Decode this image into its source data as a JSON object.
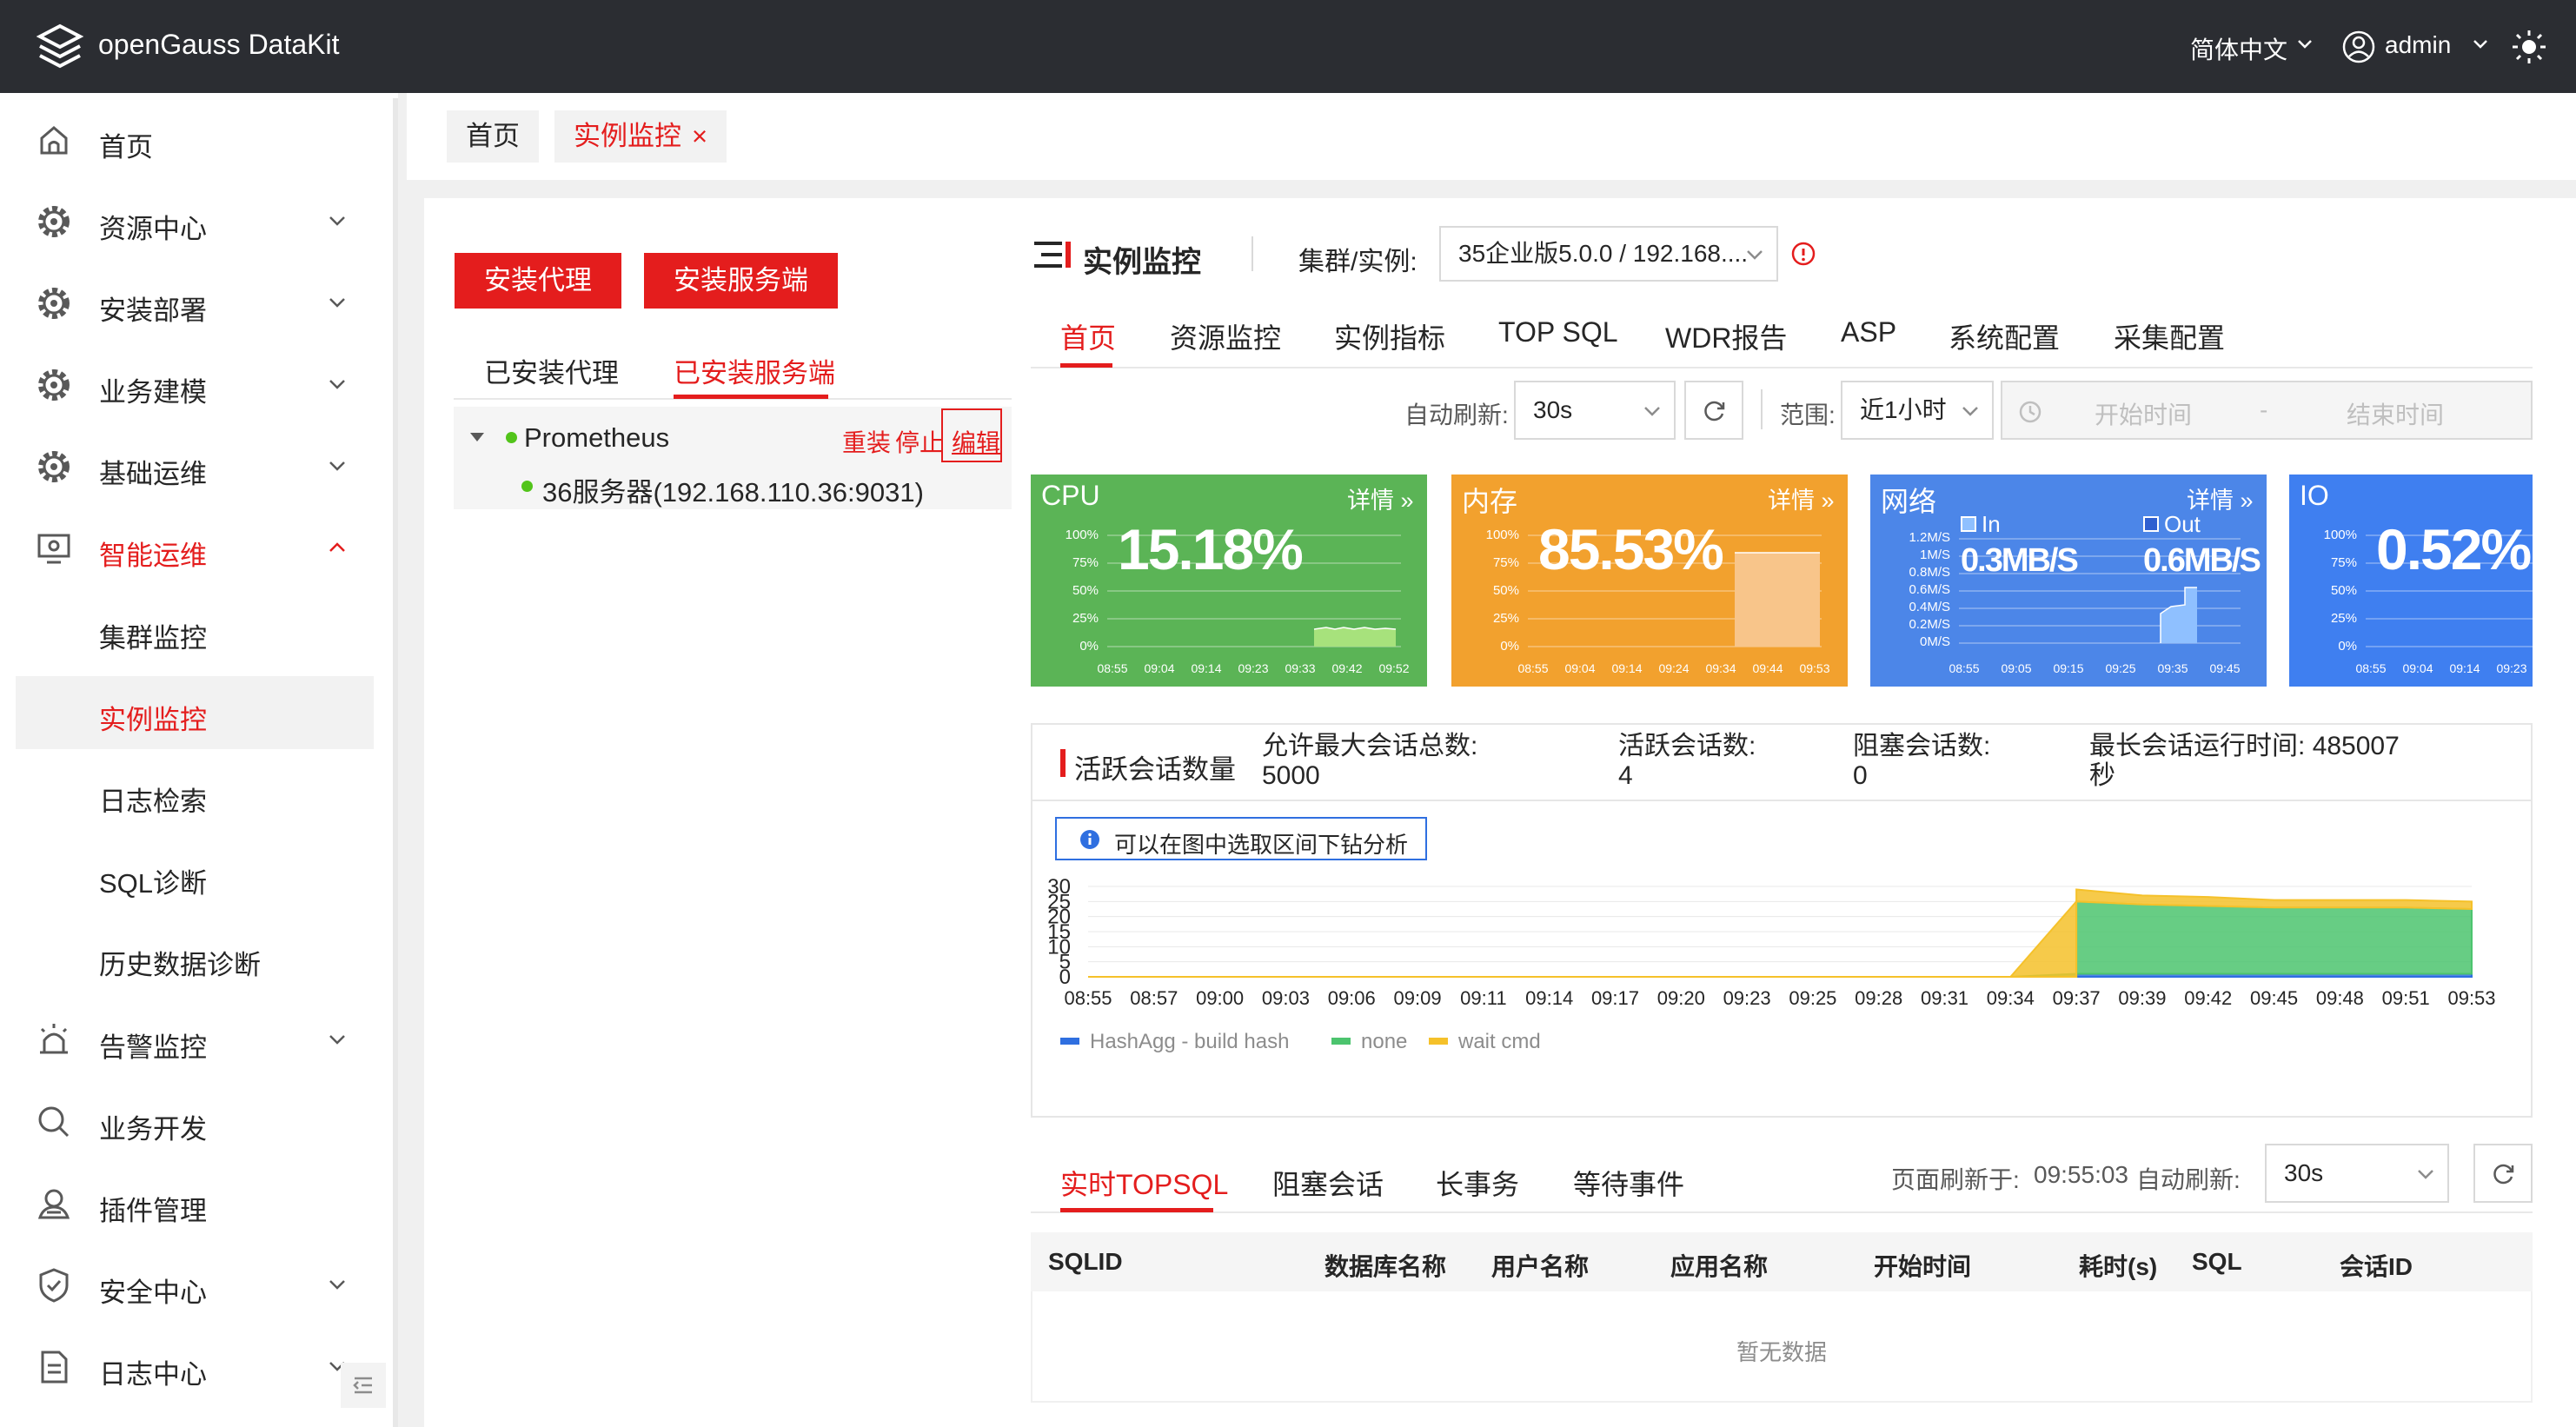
{
  "app": {
    "title": "openGauss DataKit",
    "language": "简体中文",
    "user": "admin"
  },
  "sidebar": {
    "items": [
      {
        "label": "首页",
        "icon": "home-icon"
      },
      {
        "label": "资源中心",
        "icon": "gear-icon"
      },
      {
        "label": "安装部署",
        "icon": "gear-icon"
      },
      {
        "label": "业务建模",
        "icon": "gear-icon"
      },
      {
        "label": "基础运维",
        "icon": "gear-icon"
      },
      {
        "label": "智能运维",
        "icon": "monitor-icon"
      },
      {
        "label": "告警监控",
        "icon": "alarm-icon"
      },
      {
        "label": "业务开发",
        "icon": "search-icon"
      },
      {
        "label": "插件管理",
        "icon": "plugin-icon"
      },
      {
        "label": "安全中心",
        "icon": "shield-icon"
      },
      {
        "label": "日志中心",
        "icon": "document-icon"
      }
    ],
    "subitems": [
      "集群监控",
      "实例监控",
      "日志检索",
      "SQL诊断",
      "历史数据诊断"
    ]
  },
  "page_tabs": [
    {
      "label": "首页"
    },
    {
      "label": "实例监控",
      "close": "×"
    }
  ],
  "left_panel": {
    "install_agent": "安装代理",
    "install_server": "安装服务端",
    "tab_agent": "已安装代理",
    "tab_server": "已安装服务端",
    "tree_root": "Prometheus",
    "tree_child": "36服务器(192.168.110.36:9031)",
    "action_reinstall": "重装",
    "action_stop": "停止",
    "action_edit": "编辑"
  },
  "monitor": {
    "title": "实例监控",
    "cluster_label": "集群/实例:",
    "cluster_value": "35企业版5.0.0 / 192.168....",
    "tabs": [
      "首页",
      "资源监控",
      "实例指标",
      "TOP SQL",
      "WDR报告",
      "ASP",
      "系统配置",
      "采集配置"
    ],
    "auto_refresh_label": "自动刷新:",
    "auto_refresh_value": "30s",
    "range_label": "范围:",
    "range_value": "近1小时",
    "start_placeholder": "开始时间",
    "range_sep": "-",
    "end_placeholder": "结束时间"
  },
  "cards": {
    "detail": "详情",
    "cpu": {
      "title": "CPU",
      "value": "15.18%",
      "color": "#5bb456",
      "yticks": [
        "100%",
        "75%",
        "50%",
        "25%",
        "0%"
      ],
      "xticks": [
        "08:55",
        "09:04",
        "09:14",
        "09:23",
        "09:33",
        "09:42",
        "09:52"
      ]
    },
    "mem": {
      "title": "内存",
      "value": "85.53%",
      "color": "#f2a12e",
      "yticks": [
        "100%",
        "75%",
        "50%",
        "25%",
        "0%"
      ],
      "xticks": [
        "08:55",
        "09:04",
        "09:14",
        "09:24",
        "09:34",
        "09:44",
        "09:53"
      ]
    },
    "net": {
      "title": "网络",
      "in_label": "In",
      "out_label": "Out",
      "in_value": "0.3MB/S",
      "out_value": "0.6MB/S",
      "color": "#4c86e8",
      "yticks": [
        "1.2M/S",
        "1M/S",
        "0.8M/S",
        "0.6M/S",
        "0.4M/S",
        "0.2M/S",
        "0M/S"
      ],
      "xticks": [
        "08:55",
        "09:05",
        "09:15",
        "09:25",
        "09:35",
        "09:45"
      ]
    },
    "io": {
      "title": "IO",
      "value": "0.52%",
      "color": "#3f7ff0",
      "yticks": [
        "100%",
        "75%",
        "50%",
        "25%",
        "0%"
      ],
      "xticks": [
        "08:55",
        "09:04",
        "09:14",
        "09:23"
      ]
    }
  },
  "sessions": {
    "title": "活跃会话数量",
    "max_label": "允许最大会话总数:",
    "max_value": "5000",
    "active_label": "活跃会话数:",
    "active_value": "4",
    "blocked_label": "阻塞会话数:",
    "blocked_value": "0",
    "longest_label": "最长会话运行时间:",
    "longest_value": "485007",
    "longest_unit": "秒",
    "hint": "可以在图中选取区间下钻分析"
  },
  "chart_data": {
    "type": "area",
    "title": "",
    "xlabel": "",
    "ylabel": "",
    "ylim": [
      0,
      30
    ],
    "yticks": [
      "30",
      "25",
      "20",
      "15",
      "10",
      "5",
      "0"
    ],
    "categories": [
      "08:55",
      "08:57",
      "09:00",
      "09:03",
      "09:06",
      "09:09",
      "09:11",
      "09:14",
      "09:17",
      "09:20",
      "09:23",
      "09:25",
      "09:28",
      "09:31",
      "09:34",
      "09:37",
      "09:39",
      "09:42",
      "09:45",
      "09:48",
      "09:51",
      "09:53"
    ],
    "series": [
      {
        "name": "HashAgg - build hash",
        "color": "#2f6fe0",
        "values": [
          0,
          0,
          0,
          0,
          0,
          0,
          0,
          0,
          0,
          0,
          0,
          0,
          0,
          0,
          0,
          1,
          1,
          1,
          1,
          1,
          1,
          1
        ]
      },
      {
        "name": "none",
        "color": "#4cc46e",
        "values": [
          0,
          0,
          0,
          0,
          0,
          0,
          0,
          0,
          0,
          0,
          0,
          0,
          0,
          0,
          0,
          24,
          23,
          22.5,
          22,
          22,
          22,
          21.5
        ]
      },
      {
        "name": "wait cmd",
        "color": "#f5c12a",
        "values": [
          0,
          0,
          0,
          0,
          0,
          0,
          0,
          0,
          0,
          0,
          0,
          0,
          0,
          0,
          0,
          4,
          3,
          3,
          2.5,
          2.5,
          2.5,
          2.5
        ]
      }
    ],
    "legend": "bottom-left",
    "grid": true
  },
  "topsql": {
    "tabs": [
      "实时TOPSQL",
      "阻塞会话",
      "长事务",
      "等待事件"
    ],
    "refreshed_label": "页面刷新于:",
    "refreshed_value": "09:55:03",
    "auto_refresh_label": "自动刷新:",
    "auto_refresh_value": "30s",
    "columns": [
      "SQLID",
      "数据库名称",
      "用户名称",
      "应用名称",
      "开始时间",
      "耗时(s)",
      "SQL",
      "会话ID"
    ],
    "empty": "暂无数据"
  }
}
